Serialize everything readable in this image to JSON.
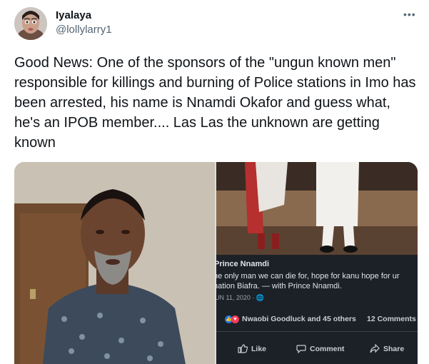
{
  "tweet": {
    "display_name": "Iyalaya",
    "handle": "@lollylarry1",
    "more_icon": "ellipsis-icon",
    "text": "Good News: One of the sponsors of the \"ungun known men\"  responsible for killings and burning of Police stations in Imo has been arrested, his name is Nnamdi Okafor and guess what, he's an IPOB member.... Las Las the unknown are getting known"
  },
  "media": {
    "fb_post": {
      "author": "Prince Nnamdi",
      "text": "he only man we can die for, hope for kanu hope for ur nation Biafra. — with Prince Nnamdi.",
      "date": "UN 11, 2020 · 🌐",
      "reactions": "Nwaobi Goodluck and 45 others",
      "comments_count": "12 Comments",
      "like_label": "Like",
      "comment_label": "Comment",
      "share_label": "Share"
    }
  },
  "colors": {
    "text": "#0f1419",
    "secondary": "#536471",
    "fb_bg": "#1c2127"
  }
}
